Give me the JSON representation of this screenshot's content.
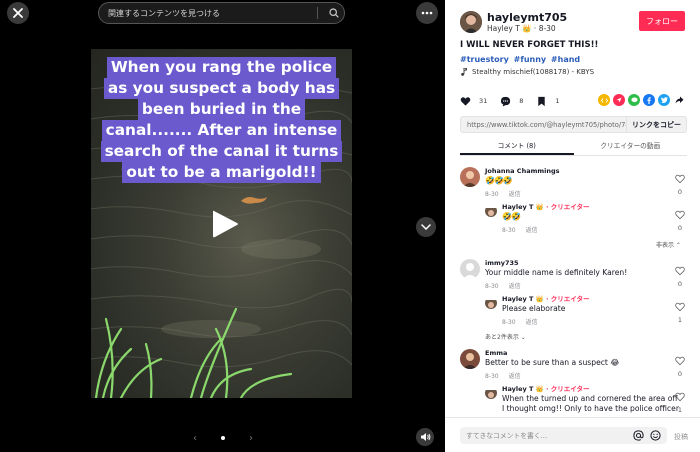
{
  "search": {
    "placeholder": "関連するコンテンツを見つける"
  },
  "video": {
    "caption_lines": [
      "When you rang the police",
      "as you suspect a body has",
      "been buried in the",
      "canal....... After an intense",
      "search of the canal it turns",
      "out to be a marigold!!"
    ],
    "pager": {
      "prev": "‹",
      "next": "›"
    }
  },
  "author": {
    "username": "hayleymt705",
    "display_name": "Hayley T",
    "crown": "👑",
    "separator": "·",
    "date": "8-30",
    "follow_label": "フォロー"
  },
  "post": {
    "title": "I WILL NEVER FORGET THIS!!",
    "hashtags": [
      "#truestory",
      "#funny",
      "#hand"
    ],
    "music": "Stealthy mischief(1088178) - KBYS"
  },
  "stats": {
    "likes": "31",
    "comments": "8",
    "saves": "1"
  },
  "share_colors": [
    "#f5b700",
    "#fe2c55",
    "#2fbd4a",
    "#1877f2",
    "#1da1f2"
  ],
  "link": {
    "url": "https://www.tiktok.com/@hayleymt705/photo/74...",
    "copy_label": "リンクをコピー"
  },
  "tabs": [
    {
      "label": "コメント (8)",
      "active": true
    },
    {
      "label": "クリエイターの動画",
      "active": false
    }
  ],
  "comments": {
    "reply_label": "返信",
    "creator_label": "· クリエイター",
    "items": [
      {
        "name": "Johanna Chammings",
        "text": "🤣🤣🤣",
        "date": "8-30",
        "likes": "0"
      },
      {
        "name": "immy735",
        "text": "Your middle name is definitely Karen!",
        "date": "8-30",
        "likes": "0"
      },
      {
        "name": "Emma",
        "text": "Better to be sure than a suspect 😂",
        "date": "8-30",
        "likes": "0"
      }
    ],
    "replies": [
      {
        "name": "Hayley T",
        "text": "🤣🤣",
        "date": "8-30",
        "likes": "0"
      },
      {
        "name": "Hayley T",
        "text": "Please elaborate",
        "date": "8-30",
        "likes": "1"
      },
      {
        "name": "Hayley T",
        "text": "When the turned up and cornered the area off",
        "text2": "I thought omg!! Only to have the police officer",
        "date": "",
        "likes": "1"
      }
    ],
    "hide_label": "非表示 ⌃",
    "more_label": "あと2件表示 ⌄"
  },
  "footer": {
    "placeholder": "すてきなコメントを書く...",
    "post_label": "投稿"
  },
  "icons": {
    "close": "close-icon",
    "search": "search-icon",
    "more": "more-dots-icon",
    "down": "chevron-down-icon",
    "volume": "volume-icon",
    "play": "play-icon"
  }
}
